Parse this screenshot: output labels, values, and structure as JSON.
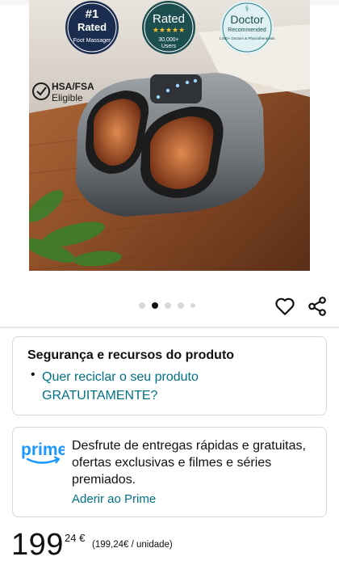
{
  "hero": {
    "badge_rank": "#1",
    "badge_rated": "Rated",
    "badge_sub": "Foot Massager",
    "rating_title": "Rated",
    "rating_stars": "★★★★★",
    "rating_count": "30,000+",
    "rating_users": "Users",
    "doctor_title": "Doctor",
    "doctor_rec": "Recommended",
    "doctor_sub": "1,500+ Doctors & Physiotherapists",
    "hsa_line1": "HSA/FSA",
    "hsa_line2": "Eligible"
  },
  "carousel": {
    "total_dots": 5,
    "active_index": 1
  },
  "safety": {
    "title": "Segurança e recursos do produto",
    "bullet": "•",
    "link": "Quer reciclar o seu produto GRATUITAMENTE?"
  },
  "prime": {
    "logo_text": "prime",
    "description": "Desfrute de entregas rápidas e gratuitas, ofertas exclusivas e filmes e séries premiados.",
    "join_link": "Aderir ao Prime"
  },
  "price": {
    "whole": "199",
    "fraction": "24 €",
    "unit_price": "(199,24€ / unidade)"
  },
  "colors": {
    "link": "#007185",
    "prime_blue": "#1a98ff",
    "badge_navy": "#1b2d4f",
    "badge_teal": "#1d4e50"
  }
}
